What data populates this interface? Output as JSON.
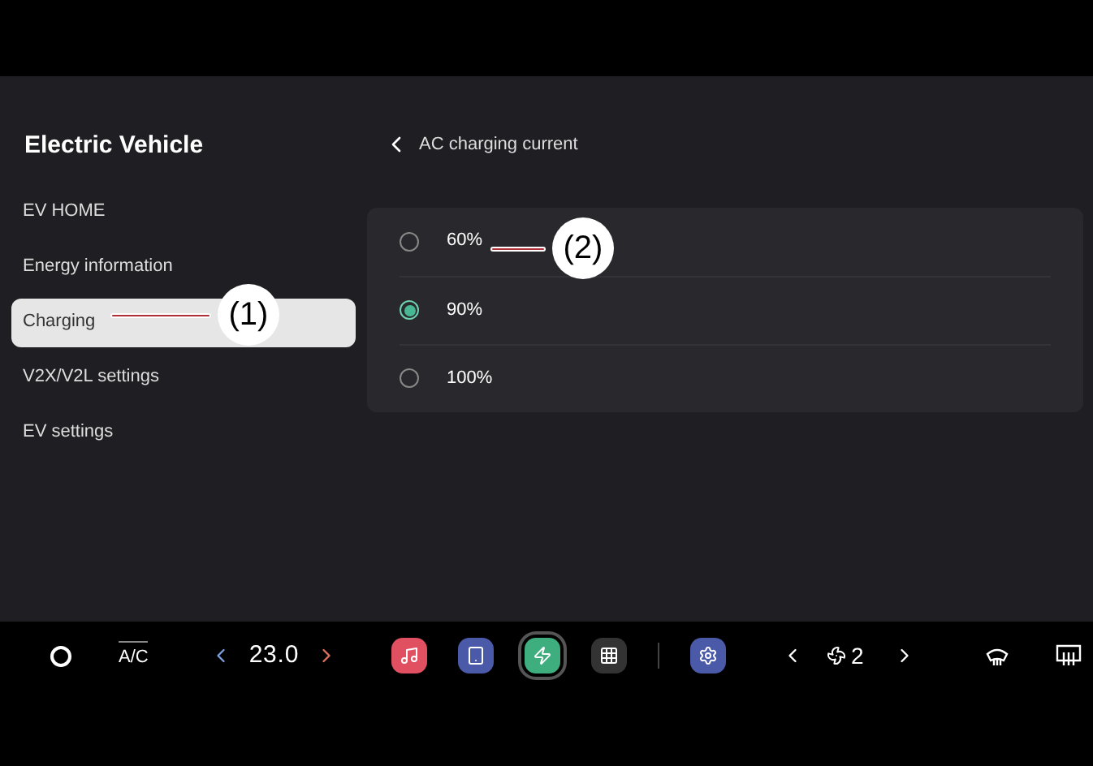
{
  "sidebar": {
    "title": "Electric Vehicle",
    "items": [
      {
        "label": "EV HOME",
        "selected": false
      },
      {
        "label": "Energy information",
        "selected": false
      },
      {
        "label": "Charging",
        "selected": true
      },
      {
        "label": "V2X/V2L settings",
        "selected": false
      },
      {
        "label": "EV settings",
        "selected": false
      }
    ]
  },
  "panel": {
    "title": "AC charging current",
    "options": [
      {
        "label": "60%",
        "selected": false
      },
      {
        "label": "90%",
        "selected": true
      },
      {
        "label": "100%",
        "selected": false
      }
    ]
  },
  "callouts": [
    {
      "label": "(1)"
    },
    {
      "label": "(2)"
    }
  ],
  "bottom_bar": {
    "ac_label": "A/C",
    "temperature": "23.0",
    "fan_speed": "2",
    "apps": [
      {
        "kind": "music",
        "selected": false
      },
      {
        "kind": "media",
        "selected": false
      },
      {
        "kind": "charge",
        "selected": true
      },
      {
        "kind": "grid",
        "selected": false
      },
      {
        "kind": "settings",
        "selected": false
      }
    ]
  }
}
